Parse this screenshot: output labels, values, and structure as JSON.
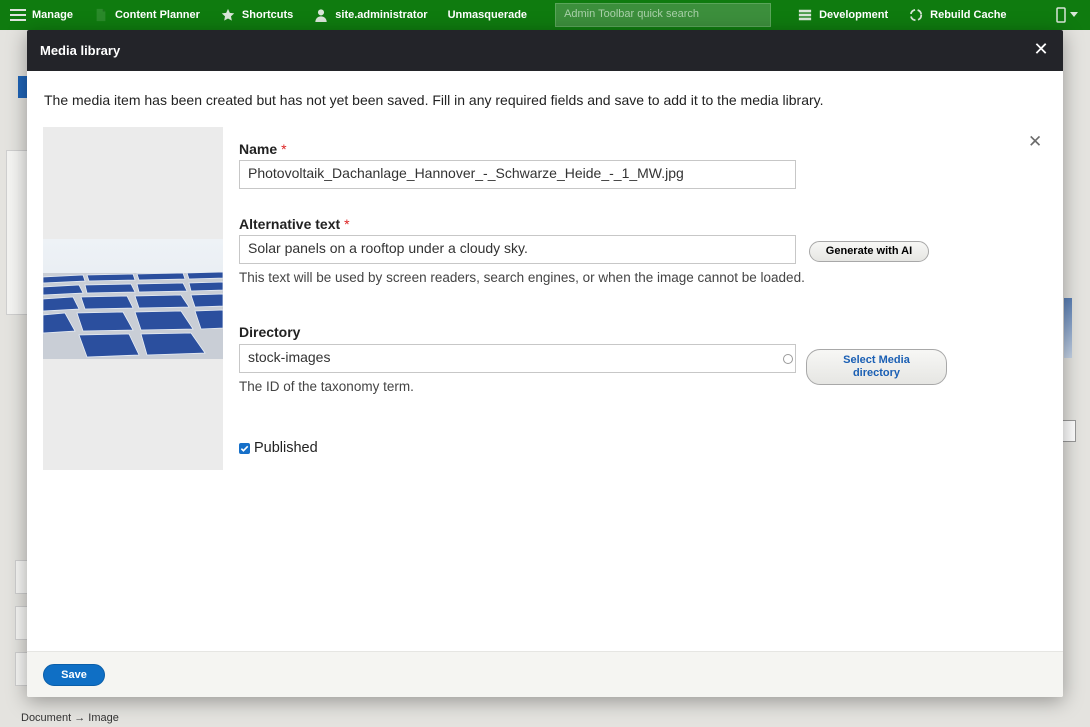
{
  "toolbar": {
    "manage": "Manage",
    "content_planner": "Content Planner",
    "shortcuts": "Shortcuts",
    "user": "site.administrator",
    "unmasquerade": "Unmasquerade",
    "search_placeholder": "Admin Toolbar quick search",
    "development": "Development",
    "rebuild_cache": "Rebuild Cache",
    "accent_color": "#0f7b0f"
  },
  "dialog": {
    "title": "Media library",
    "close_icon": "close-icon",
    "message": "The media item has been created but has not yet been saved. Fill in any required fields and save to add it to the media library.",
    "required_mark": "*",
    "name": {
      "label": "Name",
      "value": "Photovoltaik_Dachanlage_Hannover_-_Schwarze_Heide_-_1_MW.jpg"
    },
    "alt_text": {
      "label": "Alternative text",
      "value": "Solar panels on a rooftop under a cloudy sky.",
      "button": "Generate with AI",
      "description": "This text will be used by screen readers, search engines, or when the image cannot be loaded."
    },
    "directory": {
      "label": "Directory",
      "value": "stock-images",
      "button_line1": "Select Media",
      "button_line2": "directory",
      "description": "The ID of the taxonomy term."
    },
    "published": {
      "label": "Published",
      "checked": true
    },
    "save_label": "Save",
    "button_color": "#0f6fc5"
  },
  "background": {
    "breadcrumb_from": "Document",
    "breadcrumb_arrow": "→",
    "breadcrumb_to": "Image"
  }
}
